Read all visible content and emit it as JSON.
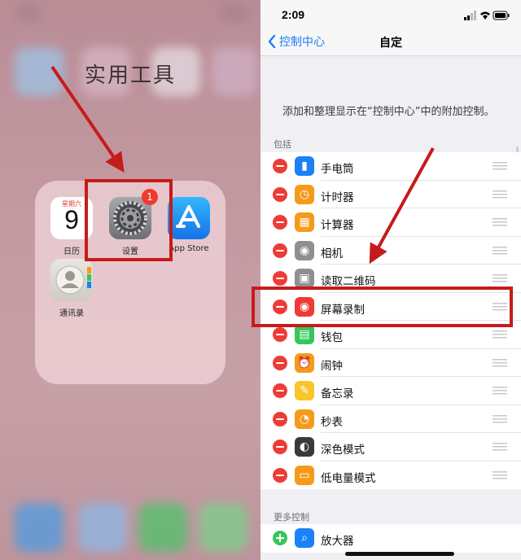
{
  "home": {
    "folder_title": "实用工具",
    "calendar": {
      "weekday": "星期六",
      "date": "9",
      "label": "日历"
    },
    "settings": {
      "label": "设置",
      "badge": "1"
    },
    "appstore": {
      "label": "App Store"
    },
    "contacts": {
      "label": "通讯录"
    }
  },
  "status": {
    "time": "2:09"
  },
  "nav": {
    "back_label": "控制中心",
    "title": "自定"
  },
  "description": "添加和整理显示在“控制中心”中的附加控制。",
  "included": {
    "header": "包括",
    "items": [
      {
        "name": "手电筒",
        "icon": "flashlight-icon",
        "color": "#1a82f7"
      },
      {
        "name": "计时器",
        "icon": "timer-icon",
        "color": "#f59a1a"
      },
      {
        "name": "计算器",
        "icon": "calculator-icon",
        "color": "#f59a1a"
      },
      {
        "name": "相机",
        "icon": "camera-icon",
        "color": "#8e8e93"
      },
      {
        "name": "读取二维码",
        "icon": "qr-code-icon",
        "color": "#8e8e93"
      },
      {
        "name": "屏幕录制",
        "icon": "screen-record-icon",
        "color": "#ee3b35"
      },
      {
        "name": "钱包",
        "icon": "wallet-icon",
        "color": "#35c759"
      },
      {
        "name": "闹钟",
        "icon": "alarm-icon",
        "color": "#f59a1a"
      },
      {
        "name": "备忘录",
        "icon": "notes-icon",
        "color": "#f8c62b"
      },
      {
        "name": "秒表",
        "icon": "stopwatch-icon",
        "color": "#f59a1a"
      },
      {
        "name": "深色模式",
        "icon": "dark-mode-icon",
        "color": "#3a3a3c"
      },
      {
        "name": "低电量模式",
        "icon": "low-power-icon",
        "color": "#f59a1a"
      }
    ]
  },
  "more": {
    "header": "更多控制",
    "items": [
      {
        "name": "放大器",
        "icon": "magnifier-icon",
        "color": "#1a82f7"
      }
    ]
  },
  "colors": {
    "annotation_red": "#c61b1b",
    "ios_blue": "#1a7cf5"
  }
}
